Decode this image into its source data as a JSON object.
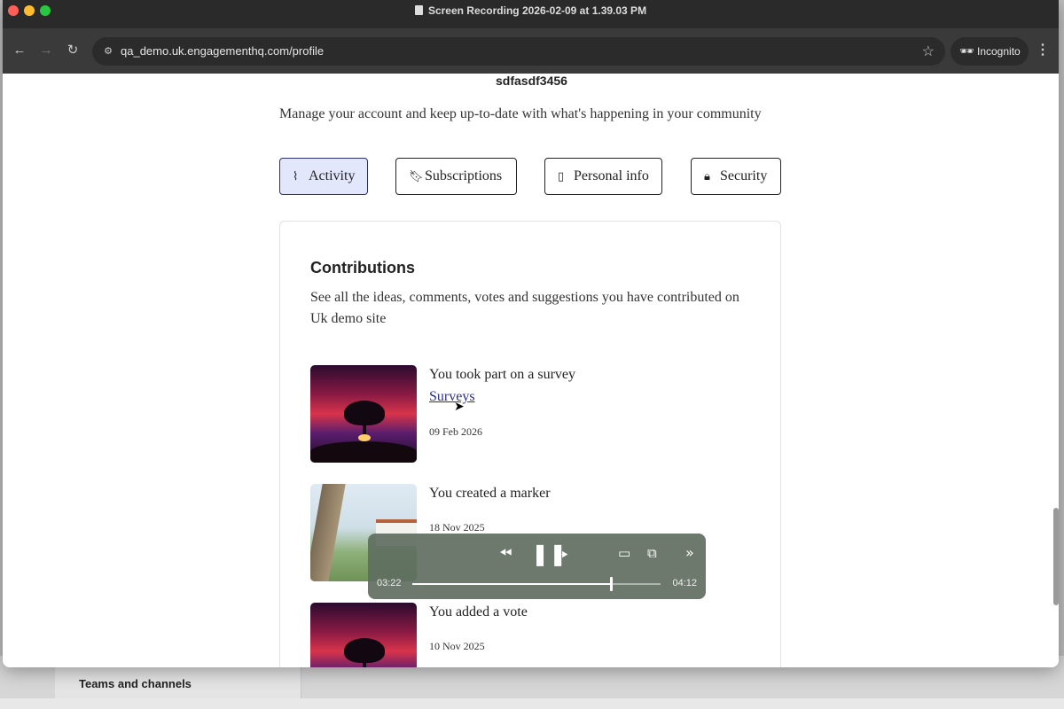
{
  "window": {
    "title": "Screen Recording 2026-02-09 at 1.39.03 PM"
  },
  "browser": {
    "url": "qa_demo.uk.engagementhq.com/profile",
    "incognito_label": "Incognito"
  },
  "profile": {
    "username": "sdfasdf3456",
    "tagline": "Manage your account and keep up-to-date with what's happening in your community"
  },
  "tabs": [
    {
      "label": "Activity",
      "icon": "activity-icon",
      "active": true
    },
    {
      "label": "Subscriptions",
      "icon": "bookmark-icon",
      "active": false
    },
    {
      "label": "Personal info",
      "icon": "clipboard-icon",
      "active": false
    },
    {
      "label": "Security",
      "icon": "lock-icon",
      "active": false
    }
  ],
  "contributions": {
    "title": "Contributions",
    "description": "See all the ideas, comments, votes and suggestions you have contributed on Uk demo site",
    "items": [
      {
        "text": "You took part on a survey",
        "link": "Surveys",
        "date": "09 Feb 2026"
      },
      {
        "text": "You created a marker",
        "date": "18 Nov 2025"
      },
      {
        "text": "You added a vote",
        "date": "10 Nov 2025"
      }
    ]
  },
  "player": {
    "current_time": "03:22",
    "total_time": "04:12",
    "progress": 0.8
  },
  "background_app": {
    "label": "Teams and channels"
  }
}
